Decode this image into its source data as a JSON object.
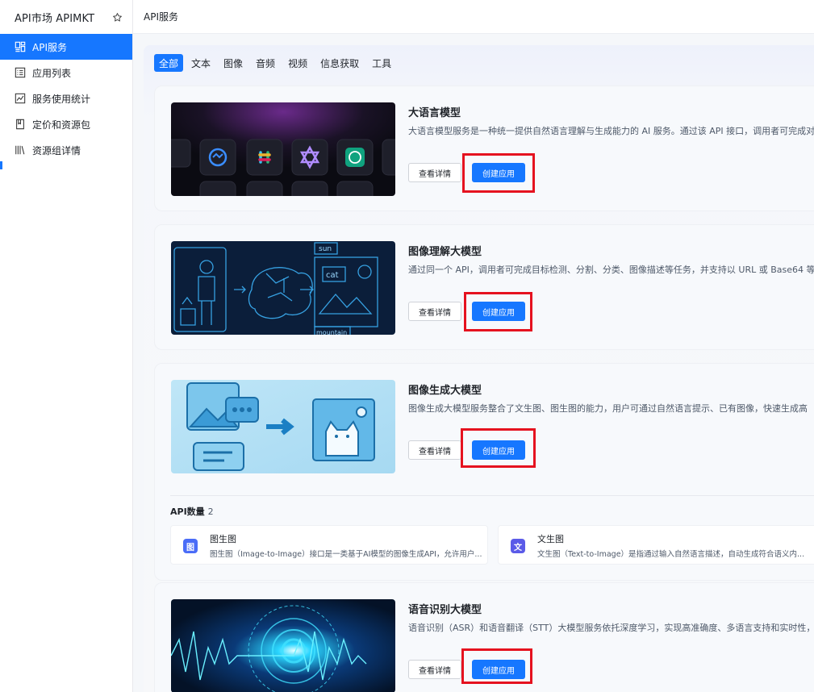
{
  "sidebar": {
    "title": "API市场 APIMKT",
    "items": [
      {
        "label": "API服务",
        "icon": "dashboard-icon",
        "active": true
      },
      {
        "label": "应用列表",
        "icon": "list-icon"
      },
      {
        "label": "服务使用统计",
        "icon": "chart-icon"
      },
      {
        "label": "定价和资源包",
        "icon": "book-icon"
      },
      {
        "label": "资源组详情",
        "icon": "library-icon"
      }
    ]
  },
  "topbar": {
    "breadcrumb": "API服务"
  },
  "tabs": [
    "全部",
    "文本",
    "图像",
    "音频",
    "视频",
    "信息获取",
    "工具"
  ],
  "buttons": {
    "detail": "查看详情",
    "create": "创建应用"
  },
  "cards": [
    {
      "title": "大语言模型",
      "desc": "大语言模型服务是一种统一提供自然语言理解与生成能力的 AI 服务。通过该 API 接口，调用者可完成对"
    },
    {
      "title": "图像理解大模型",
      "desc": "通过同一个 API，调用者可完成目标检测、分割、分类、图像描述等任务，并支持以 URL 或 Base64 等"
    },
    {
      "title": "图像生成大模型",
      "desc": "图像生成大模型服务整合了文生图、图生图的能力，用户可通过自然语言提示、已有图像，快速生成高"
    },
    {
      "title": "语音识别大模型",
      "desc": "语音识别（ASR）和语音翻译（STT）大模型服务依托深度学习，实现高准确度、多语言支持和实时性，"
    }
  ],
  "thumb_labels": {
    "sun": "sun",
    "cat": "cat",
    "mountain": "mountain"
  },
  "api_section": {
    "label": "API数量",
    "count": "2",
    "apis": [
      {
        "icon_text": "图",
        "name": "图生图",
        "desc": "图生图（Image-to-Image）接口是一类基于AI模型的图像生成API，允许用户..."
      },
      {
        "icon_text": "文",
        "name": "文生图",
        "desc": "文生图（Text-to-Image）是指通过输入自然语言描述，自动生成符合语义内..."
      }
    ]
  },
  "colors": {
    "accent": "#1677ff",
    "highlight": "#e5121f"
  }
}
